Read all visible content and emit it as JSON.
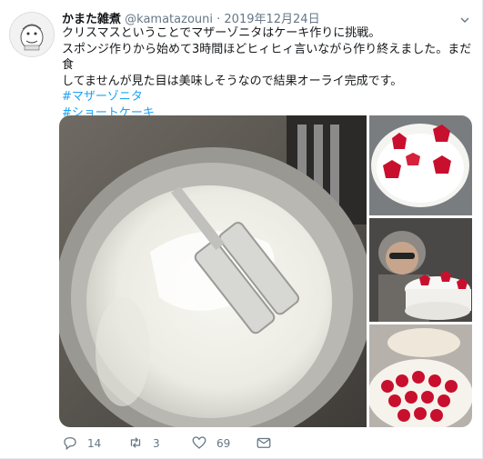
{
  "tweet": {
    "display_name": "かまた雑煮",
    "handle": "@kamatazouni",
    "separator": "·",
    "date": "2019年12月24日",
    "lines": [
      "クリスマスということでマザーゾニタはケーキ作りに挑戦。",
      "スポンジ作りから始めて3時間ほどヒィヒィ言いながら作り終えました。まだ食",
      "してませんが見た目は美味しそうなので結果オーライ完成です。"
    ],
    "hashtags": [
      "#マザーゾニタ",
      "#ショートケーキ"
    ]
  },
  "actions": {
    "reply_count": "14",
    "retweet_count": "3",
    "like_count": "69"
  },
  "icons": {
    "caret": "chevron-down-icon",
    "reply": "reply-icon",
    "retweet": "retweet-icon",
    "like": "heart-icon",
    "message": "envelope-icon"
  },
  "colors": {
    "link": "#1da1f2",
    "text": "#14171a",
    "muted": "#657786",
    "strawberry": "#c8102e"
  }
}
